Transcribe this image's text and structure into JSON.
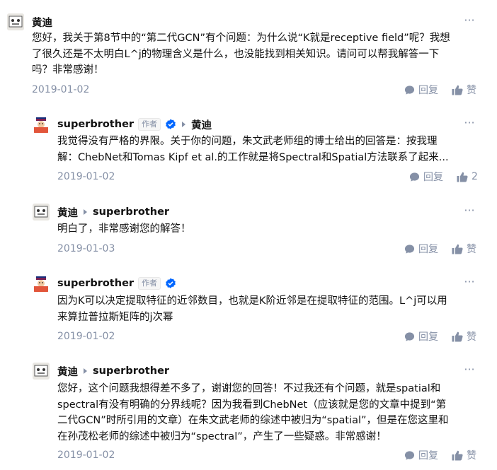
{
  "comments": [
    {
      "author": "黄迪",
      "lines": [
        "您好，我关于第8节中的“第二代GCN”有个问题：为什么说“K就是receptive field”呢？我想",
        "了很久还是不太明白L^j的物理含义是什么，也没能找到相关知识。请问可以帮我解答一下",
        "吗？非常感谢！"
      ],
      "date": "2019-01-02",
      "reply_label": "回复",
      "like_label": "赞"
    },
    {
      "author": "superbrother",
      "author_tag": "作者",
      "reply_to": "黄迪",
      "lines": [
        "我觉得没有严格的界限。关于你的问题，朱文武老师组的博士给出的回答是：按我理",
        "解：ChebNet和Tomas Kipf et al.的工作就是将Spectral和Spatial方法联系了起来..."
      ],
      "date": "2019-01-02",
      "reply_label": "回复",
      "like_label": "2"
    },
    {
      "author": "黄迪",
      "reply_to": "superbrother",
      "lines": [
        "明白了，非常感谢您的解答！"
      ],
      "date": "2019-01-03",
      "reply_label": "回复",
      "like_label": "赞"
    },
    {
      "author": "superbrother",
      "author_tag": "作者",
      "lines": [
        "因为K可以决定提取特征的近邻数目，也就是K阶近邻是在提取特征的范围。L^j可以用",
        "来算拉普拉斯矩阵的j次幂"
      ],
      "date": "2019-01-02",
      "reply_label": "回复",
      "like_label": "赞"
    },
    {
      "author": "黄迪",
      "reply_to": "superbrother",
      "lines": [
        "您好，这个问题我想得差不多了，谢谢您的回答！不过我还有个问题，就是spatial和",
        "spectral有没有明确的分界线呢？因为我看到ChebNet（应该就是您的文章中提到“第",
        "二代GCN”时所引用的文章）在朱文武老师的综述中被归为“spatial”，但是在您这里和",
        "在孙茂松老师的综述中被归为“spectral”，产生了一些疑惑。非常感谢！"
      ],
      "date": "2019-01-02",
      "reply_label": "回复",
      "like_label": "赞"
    }
  ],
  "icons": {
    "more": "more-dots-icon",
    "reply": "comment-bubble-icon",
    "like": "thumb-up-icon",
    "verified": "verified-badge-icon",
    "reply_arrow": "reply-arrow-icon"
  },
  "colors": {
    "text": "#121212",
    "meta": "#8590a6",
    "verified": "#0066ff"
  }
}
